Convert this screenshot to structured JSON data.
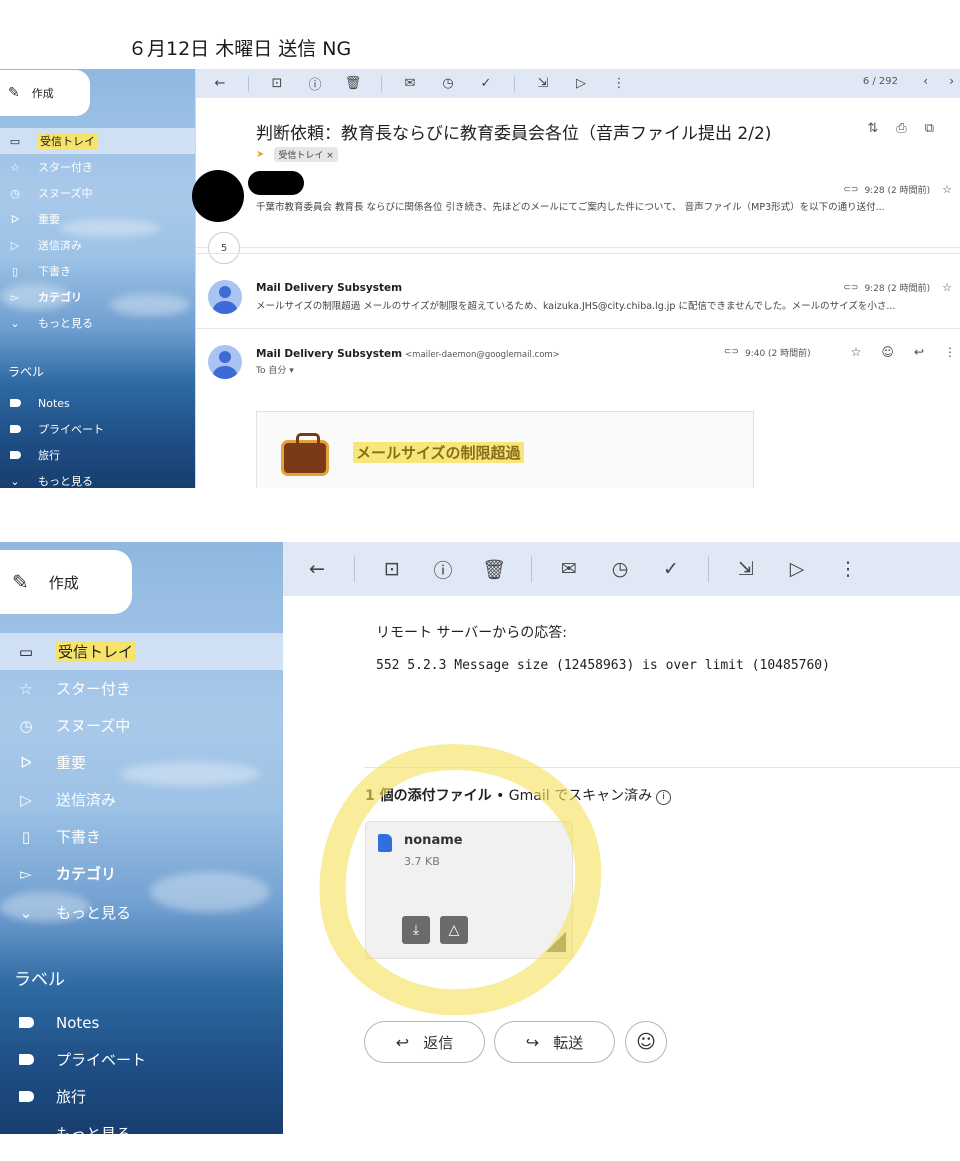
{
  "caption": "６月12日 木曜日 送信 NG",
  "sidebar": {
    "compose_label": "作成",
    "items": [
      {
        "label": "受信トレイ",
        "icon": "inbox-icon"
      },
      {
        "label": "スター付き",
        "icon": "star-icon"
      },
      {
        "label": "スヌーズ中",
        "icon": "clock-icon"
      },
      {
        "label": "重要",
        "icon": "important-icon"
      },
      {
        "label": "送信済み",
        "icon": "send-icon"
      },
      {
        "label": "下書き",
        "icon": "draft-icon"
      },
      {
        "label": "カテゴリ",
        "icon": "category-icon"
      },
      {
        "label": "もっと見る",
        "icon": "chevron-down-icon"
      }
    ],
    "labels_heading": "ラベル",
    "add_label": "+",
    "labels": [
      {
        "label": "Notes"
      },
      {
        "label": "プライベート"
      },
      {
        "label": "旅行"
      },
      {
        "label": "もっと見る"
      }
    ]
  },
  "toolbar": {
    "back": "←",
    "page_count": "6 / 292",
    "prev": "‹",
    "next": "›"
  },
  "thread": {
    "subject": "判断依頼：教育長ならびに教育委員会各位（音声ファイル提出 2/2)",
    "label_chip": "受信トレイ ×",
    "messages": [
      {
        "time": "9:28 (2 時間前)",
        "snippet": "千葉市教育委員会 教育長 ならびに関係各位 引き続き、先ほどのメールにてご案内した件について、 音声ファイル（MP3形式）を以下の通り送付..."
      },
      {
        "sender": "Mail Delivery Subsystem",
        "time": "9:28 (2 時間前)",
        "snippet": "メールサイズの制限超過 メールのサイズが制限を超えているため、kaizuka.JHS@city.chiba.lg.jp に配信できませんでした。メールのサイズを小さ..."
      },
      {
        "sender": "Mail Delivery Subsystem",
        "address": "<mailer-daemon@googlemail.com>",
        "time": "9:40 (2 時間前)",
        "to": "To 自分 ▾"
      }
    ],
    "collapsed_count": "5",
    "bounce_title": "メールサイズの制限超過"
  },
  "detail": {
    "remote_label": "リモート サーバーからの応答:",
    "remote_code": "552 5.2.3 Message size (12458963) is over limit (10485760)",
    "attachment_heading": "1 個の添付ファイル",
    "attachment_scan": " • Gmail でスキャン済み",
    "attachment": {
      "name": "noname",
      "size": "3.7 KB"
    },
    "reply_label": "返信",
    "forward_label": "転送"
  },
  "colors": {
    "highlight": "#f6e36b",
    "toolbar_bg": "#dfe8f4",
    "active_nav": "#d7e4f6"
  }
}
